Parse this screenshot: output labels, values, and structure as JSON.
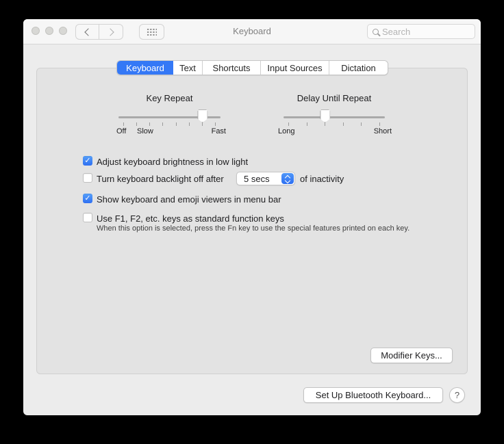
{
  "colors": {
    "accent": "#3478f6",
    "window_bg": "#ececec",
    "pane_bg": "#e3e3e3"
  },
  "titlebar": {
    "title": "Keyboard",
    "search_placeholder": "Search"
  },
  "tabs": [
    {
      "label": "Keyboard",
      "selected": true
    },
    {
      "label": "Text",
      "selected": false
    },
    {
      "label": "Shortcuts",
      "selected": false
    },
    {
      "label": "Input Sources",
      "selected": false
    },
    {
      "label": "Dictation",
      "selected": false
    }
  ],
  "sliders": {
    "key_repeat": {
      "title": "Key Repeat",
      "tick_count": 8,
      "thumb_tick": 7,
      "labels": [
        "Off",
        "Slow",
        "Fast"
      ]
    },
    "delay_until_repeat": {
      "title": "Delay Until Repeat",
      "tick_count": 6,
      "thumb_tick": 3,
      "labels": [
        "Long",
        "Short"
      ]
    }
  },
  "checkboxes": [
    {
      "label": "Adjust keyboard brightness in low light",
      "checked": true
    },
    {
      "label": "Turn keyboard backlight off after",
      "checked": false
    },
    {
      "label": "Show keyboard and emoji viewers in menu bar",
      "checked": true
    },
    {
      "label": "Use F1, F2, etc. keys as standard function keys",
      "checked": false
    }
  ],
  "backlight_popup": {
    "value": "5 secs",
    "suffix": "of inactivity"
  },
  "function_keys_note": "When this option is selected, press the Fn key to use the special features printed on each key.",
  "buttons": {
    "modifier_keys": "Modifier Keys...",
    "setup_bluetooth": "Set Up Bluetooth Keyboard...",
    "help": "?"
  }
}
